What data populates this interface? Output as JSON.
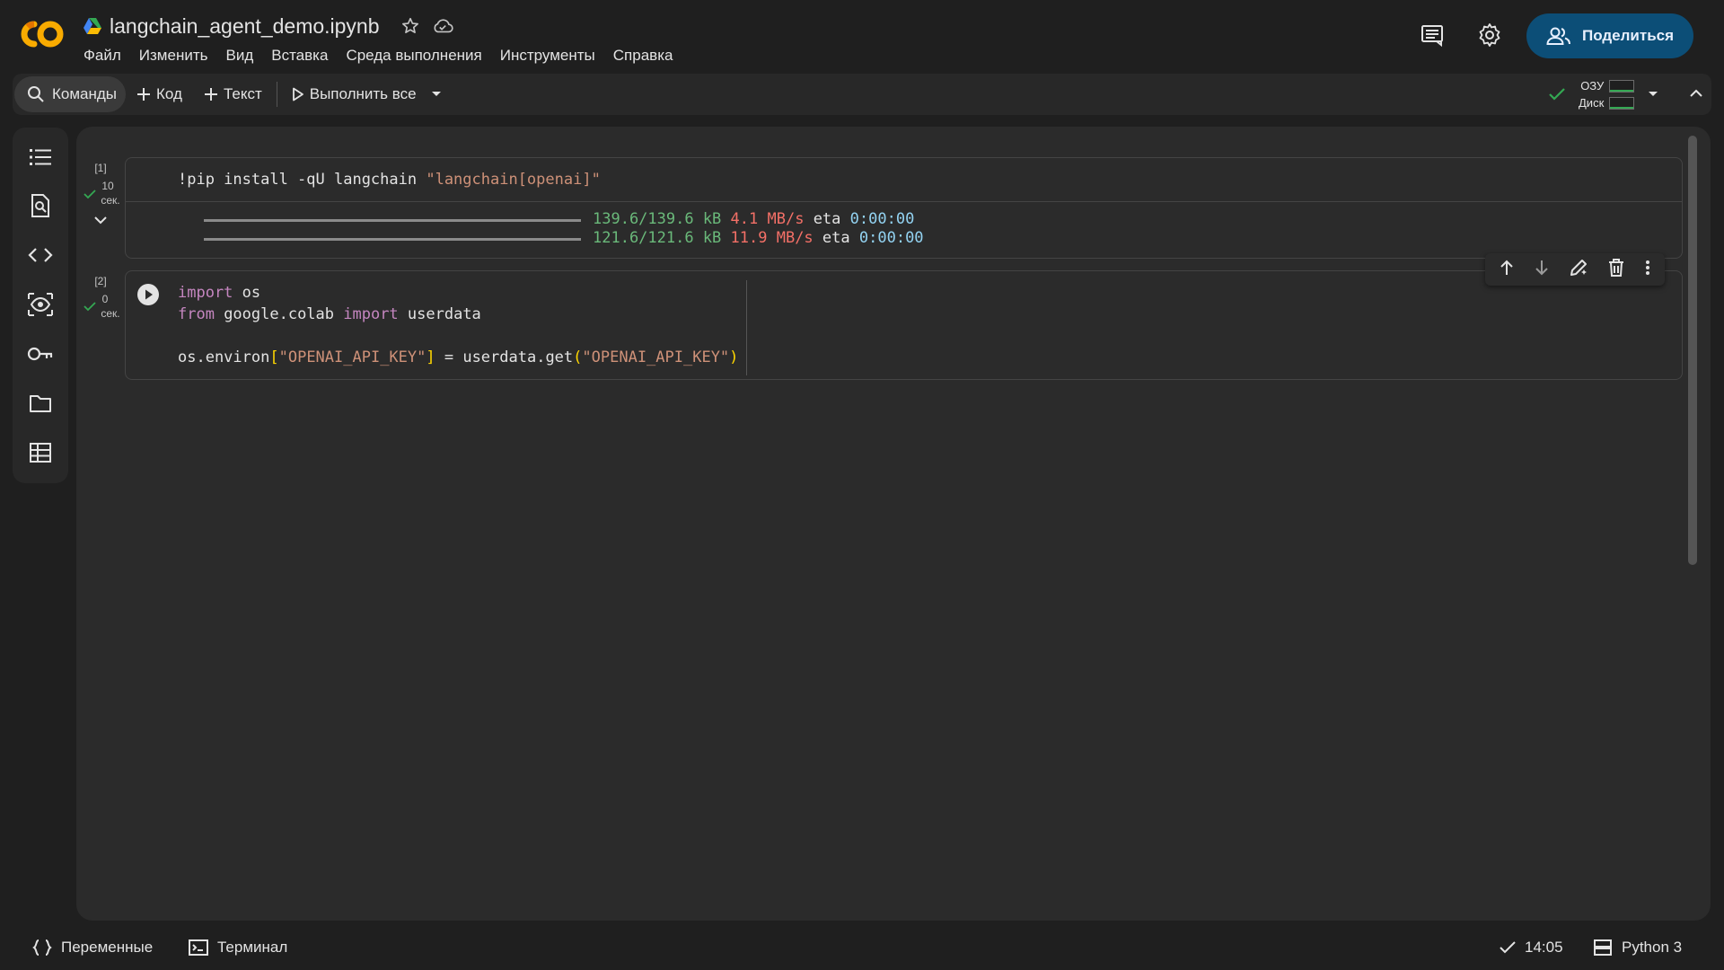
{
  "header": {
    "notebook_title": "langchain_agent_demo.ipynb",
    "menu": [
      "Файл",
      "Изменить",
      "Вид",
      "Вставка",
      "Среда выполнения",
      "Инструменты",
      "Справка"
    ],
    "share_label": "Поделиться"
  },
  "toolbar": {
    "search_label": "Команды",
    "add_code_label": "Код",
    "add_text_label": "Текст",
    "run_all_label": "Выполнить все",
    "ram_label": "ОЗУ",
    "disk_label": "Диск"
  },
  "cells": [
    {
      "exec_count": "[1]",
      "duration_value": "10",
      "duration_unit": "сек.",
      "code": {
        "cmd": "!pip install -qU langchain ",
        "arg": "\"langchain[openai]\""
      },
      "output": [
        {
          "progress": "139.6/139.6 kB",
          "speed": "4.1 MB/s",
          "eta_label": "eta",
          "eta": "0:00:00"
        },
        {
          "progress": "121.6/121.6 kB",
          "speed": "11.9 MB/s",
          "eta_label": "eta",
          "eta": "0:00:00"
        }
      ]
    },
    {
      "exec_count": "[2]",
      "duration_value": "0",
      "duration_unit": "сек.",
      "code": {
        "l1_kw": "import",
        "l1_rest": " os",
        "l2_kw1": "from",
        "l2_mod": " google.colab ",
        "l2_kw2": "import",
        "l2_rest": " userdata",
        "l3_a": "os.environ",
        "l3_b1": "[",
        "l3_s1": "\"OPENAI_API_KEY\"",
        "l3_b2": "]",
        "l3_c": " = userdata.get",
        "l3_p1": "(",
        "l3_s2": "\"OPENAI_API_KEY\"",
        "l3_p2": ")"
      }
    }
  ],
  "statusbar": {
    "variables_label": "Переменные",
    "terminal_label": "Терминал",
    "time": "14:05",
    "runtime_label": "Python 3"
  }
}
